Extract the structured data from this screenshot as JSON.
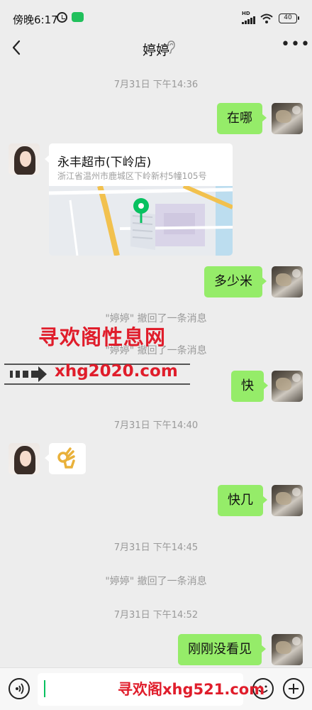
{
  "status_bar": {
    "time": "傍晚6:17",
    "network": "HD",
    "battery": "40"
  },
  "header": {
    "title": "婷婷"
  },
  "messages": {
    "time_1": "7月31日 下午14:36",
    "msg_where": "在哪",
    "location": {
      "name": "永丰超市(下岭店)",
      "address": "浙江省温州市鹿城区下岭新村5幢105号"
    },
    "msg_how_much": "多少米",
    "recall_1": "\"婷婷\" 撤回了一条消息",
    "recall_2": "\"婷婷\" 撤回了一条消息",
    "msg_fast": "快",
    "time_2": "7月31日 下午14:40",
    "emoji": "👌",
    "msg_how_fast": "快几",
    "time_3": "7月31日 下午14:45",
    "recall_3": "\"婷婷\" 撤回了一条消息",
    "time_4": "7月31日 下午14:52",
    "msg_didnt_see": "刚刚没看见"
  },
  "watermark": {
    "title": "寻欢阁性息网",
    "url": "xhg2020.com",
    "bottom": "寻欢阁xhg521.com"
  },
  "input": {
    "value": ""
  },
  "colors": {
    "bubble_me": "#95ec69",
    "background": "#ededed",
    "map_pin": "#07c160",
    "watermark": "#e01d2b"
  }
}
